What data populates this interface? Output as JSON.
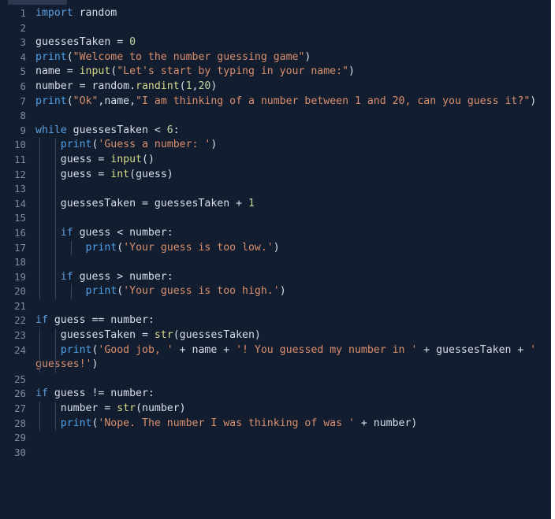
{
  "editor": {
    "theme_name": "dark-navy",
    "background_color": "#131d30",
    "gutter_color": "#7f8c9e",
    "indent_guide_color": "#3a4561",
    "tab_strip_color": "#2c3950",
    "language": "python",
    "colors": {
      "keyword": "#5c9fdd",
      "function": "#4ea1e8",
      "builtin": "#d6d98a",
      "string": "#d98f6c",
      "number": "#c3d6a0",
      "plain": "#d8dee9"
    }
  },
  "lines": [
    {
      "number": "1",
      "guides": 0,
      "tokens": [
        {
          "t": "import",
          "c": "kw"
        },
        {
          "t": " random",
          "c": "pl"
        }
      ]
    },
    {
      "number": "2",
      "guides": 0,
      "tokens": []
    },
    {
      "number": "3",
      "guides": 0,
      "tokens": [
        {
          "t": "guessesTaken = ",
          "c": "pl"
        },
        {
          "t": "0",
          "c": "num"
        }
      ]
    },
    {
      "number": "4",
      "guides": 0,
      "tokens": [
        {
          "t": "print",
          "c": "fn"
        },
        {
          "t": "(",
          "c": "pl"
        },
        {
          "t": "\"Welcome to the number guessing game\"",
          "c": "str"
        },
        {
          "t": ")",
          "c": "pl"
        }
      ]
    },
    {
      "number": "5",
      "guides": 0,
      "tokens": [
        {
          "t": "name = ",
          "c": "pl"
        },
        {
          "t": "input",
          "c": "bi"
        },
        {
          "t": "(",
          "c": "pl"
        },
        {
          "t": "\"Let's start by typing in your name:\"",
          "c": "str"
        },
        {
          "t": ")",
          "c": "pl"
        }
      ]
    },
    {
      "number": "6",
      "guides": 0,
      "tokens": [
        {
          "t": "number = random.",
          "c": "pl"
        },
        {
          "t": "randint",
          "c": "bi"
        },
        {
          "t": "(",
          "c": "pl"
        },
        {
          "t": "1",
          "c": "num"
        },
        {
          "t": ",",
          "c": "pl"
        },
        {
          "t": "20",
          "c": "num"
        },
        {
          "t": ")",
          "c": "pl"
        }
      ]
    },
    {
      "number": "7",
      "guides": 0,
      "tokens": [
        {
          "t": "print",
          "c": "fn"
        },
        {
          "t": "(",
          "c": "pl"
        },
        {
          "t": "\"Ok\"",
          "c": "str"
        },
        {
          "t": ",name,",
          "c": "pl"
        },
        {
          "t": "\"I am thinking of a number between 1 and 20, can you guess it?\"",
          "c": "str"
        },
        {
          "t": ")",
          "c": "pl"
        }
      ]
    },
    {
      "number": "8",
      "guides": 0,
      "tokens": []
    },
    {
      "number": "9",
      "guides": 0,
      "tokens": [
        {
          "t": "while",
          "c": "kw"
        },
        {
          "t": " guessesTaken < ",
          "c": "pl"
        },
        {
          "t": "6",
          "c": "num"
        },
        {
          "t": ":",
          "c": "pl"
        }
      ]
    },
    {
      "number": "10",
      "guides": 2,
      "tokens": [
        {
          "t": "    ",
          "c": "pl"
        },
        {
          "t": "print",
          "c": "fn"
        },
        {
          "t": "(",
          "c": "pl"
        },
        {
          "t": "'Guess a number: '",
          "c": "str"
        },
        {
          "t": ")",
          "c": "pl"
        }
      ]
    },
    {
      "number": "11",
      "guides": 2,
      "tokens": [
        {
          "t": "    guess = ",
          "c": "pl"
        },
        {
          "t": "input",
          "c": "bi"
        },
        {
          "t": "()",
          "c": "pl"
        }
      ]
    },
    {
      "number": "12",
      "guides": 2,
      "tokens": [
        {
          "t": "    guess = ",
          "c": "pl"
        },
        {
          "t": "int",
          "c": "bi"
        },
        {
          "t": "(guess)",
          "c": "pl"
        }
      ]
    },
    {
      "number": "13",
      "guides": 2,
      "tokens": []
    },
    {
      "number": "14",
      "guides": 2,
      "tokens": [
        {
          "t": "    guessesTaken = guessesTaken + ",
          "c": "pl"
        },
        {
          "t": "1",
          "c": "num"
        }
      ]
    },
    {
      "number": "15",
      "guides": 2,
      "tokens": []
    },
    {
      "number": "16",
      "guides": 2,
      "tokens": [
        {
          "t": "    ",
          "c": "pl"
        },
        {
          "t": "if",
          "c": "kw"
        },
        {
          "t": " guess < number:",
          "c": "pl"
        }
      ]
    },
    {
      "number": "17",
      "guides": 3,
      "tokens": [
        {
          "t": "        ",
          "c": "pl"
        },
        {
          "t": "print",
          "c": "fn"
        },
        {
          "t": "(",
          "c": "pl"
        },
        {
          "t": "'Your guess is too low.'",
          "c": "str"
        },
        {
          "t": ")",
          "c": "pl"
        }
      ]
    },
    {
      "number": "18",
      "guides": 2,
      "tokens": []
    },
    {
      "number": "19",
      "guides": 2,
      "tokens": [
        {
          "t": "    ",
          "c": "pl"
        },
        {
          "t": "if",
          "c": "kw"
        },
        {
          "t": " guess > number:",
          "c": "pl"
        }
      ]
    },
    {
      "number": "20",
      "guides": 3,
      "tokens": [
        {
          "t": "        ",
          "c": "pl"
        },
        {
          "t": "print",
          "c": "fn"
        },
        {
          "t": "(",
          "c": "pl"
        },
        {
          "t": "'Your guess is too high.'",
          "c": "str"
        },
        {
          "t": ")",
          "c": "pl"
        }
      ]
    },
    {
      "number": "21",
      "guides": 0,
      "tokens": []
    },
    {
      "number": "22",
      "guides": 0,
      "tokens": [
        {
          "t": "if",
          "c": "kw"
        },
        {
          "t": " guess == number:",
          "c": "pl"
        }
      ]
    },
    {
      "number": "23",
      "guides": 2,
      "tokens": [
        {
          "t": "    guessesTaken = ",
          "c": "pl"
        },
        {
          "t": "str",
          "c": "bi"
        },
        {
          "t": "(guessesTaken)",
          "c": "pl"
        }
      ]
    },
    {
      "number": "24",
      "guides": 2,
      "tokens": [
        {
          "t": "    ",
          "c": "pl"
        },
        {
          "t": "print",
          "c": "fn"
        },
        {
          "t": "(",
          "c": "pl"
        },
        {
          "t": "'Good job, '",
          "c": "str"
        },
        {
          "t": " + name + ",
          "c": "pl"
        },
        {
          "t": "'! You guessed my number in '",
          "c": "str"
        },
        {
          "t": " + guessesTaken + ",
          "c": "pl"
        },
        {
          "t": "' guesses!'",
          "c": "str"
        },
        {
          "t": ")",
          "c": "pl"
        }
      ]
    },
    {
      "number": "25",
      "guides": 0,
      "tokens": []
    },
    {
      "number": "26",
      "guides": 0,
      "tokens": [
        {
          "t": "if",
          "c": "kw"
        },
        {
          "t": " guess != number:",
          "c": "pl"
        }
      ]
    },
    {
      "number": "27",
      "guides": 2,
      "tokens": [
        {
          "t": "    number = ",
          "c": "pl"
        },
        {
          "t": "str",
          "c": "bi"
        },
        {
          "t": "(number)",
          "c": "pl"
        }
      ]
    },
    {
      "number": "28",
      "guides": 2,
      "tokens": [
        {
          "t": "    ",
          "c": "pl"
        },
        {
          "t": "print",
          "c": "fn"
        },
        {
          "t": "(",
          "c": "pl"
        },
        {
          "t": "'Nope. The number I was thinking of was '",
          "c": "str"
        },
        {
          "t": " + number)",
          "c": "pl"
        }
      ]
    },
    {
      "number": "29",
      "guides": 0,
      "tokens": []
    },
    {
      "number": "30",
      "guides": 0,
      "tokens": []
    }
  ]
}
